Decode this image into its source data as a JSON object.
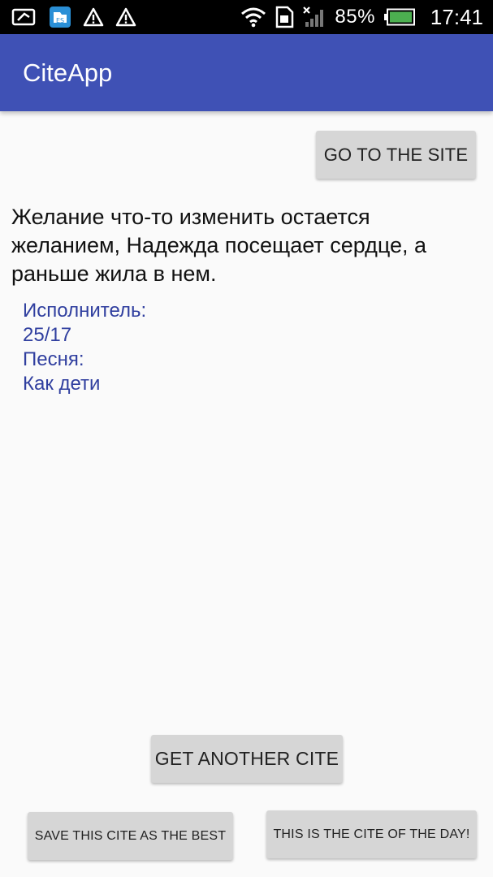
{
  "status_bar": {
    "battery_percent": "85%",
    "time": "17:41",
    "icons": [
      "notification-icon",
      "app-notification-icon",
      "warning-icon",
      "warning-icon",
      "wifi-icon",
      "sd-card-icon",
      "signal-icon",
      "battery-icon"
    ]
  },
  "app_bar": {
    "title": "CiteApp"
  },
  "buttons": {
    "go_to_site": "GO TO THE SITE",
    "get_another": "GET ANOTHER CITE",
    "save_best": "SAVE THIS CITE AS THE BEST",
    "cite_of_day": "THIS IS THE CITE OF THE DAY!"
  },
  "cite": {
    "text": "Желание что-то изменить остается желанием, Надежда посещает сердце, а раньше жила в нем.",
    "artist_label": "Исполнитель:",
    "artist": "25/17",
    "song_label": "Песня:",
    "song": "Как дети"
  },
  "colors": {
    "app_bar": "#3f51b5",
    "meta_text": "#303f9f",
    "button": "#d6d6d6",
    "background": "#fafafa"
  }
}
